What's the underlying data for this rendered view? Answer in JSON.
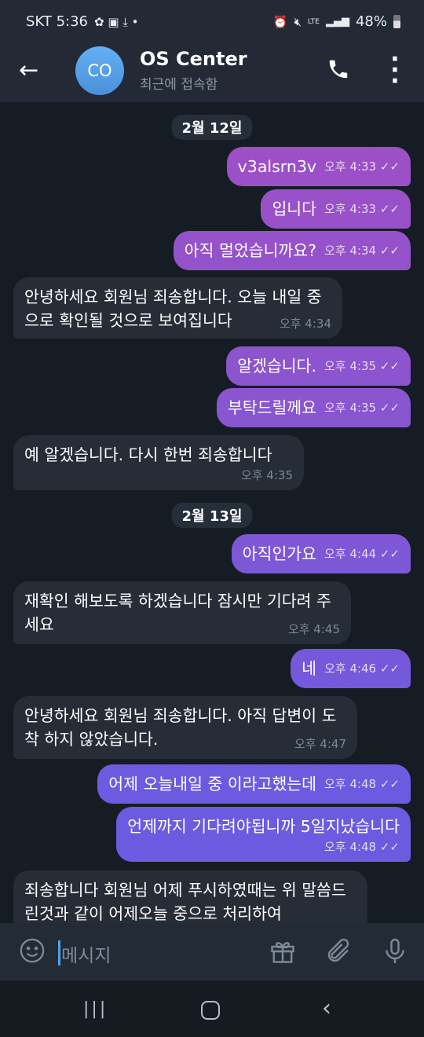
{
  "status_bar": {
    "carrier": "SKT",
    "time": "5:36",
    "battery": "48%",
    "network": "LTE"
  },
  "header": {
    "avatar_initials": "CO",
    "title": "OS Center",
    "subtitle": "최근에 접속함"
  },
  "colors": {
    "outgoing_top": "#a94cc2",
    "outgoing_bottom": "#6c5be0",
    "incoming": "#262d37",
    "background": "#161c23",
    "header": "#232a36"
  },
  "messages": [
    {
      "type": "date",
      "text": "2월 12일"
    },
    {
      "type": "out",
      "text": "v3alsrn3v",
      "time": "오후 4:33"
    },
    {
      "type": "out",
      "text": "입니다",
      "time": "오후 4:33"
    },
    {
      "type": "out",
      "text": "아직 멀었습니까요?",
      "time": "오후 4:34"
    },
    {
      "type": "in",
      "text": "안녕하세요 회원님 죄송합니다. 오늘 내일 중으로 확인될 것으로 보여집니다",
      "time": "오후 4:34"
    },
    {
      "type": "out",
      "text": "알겠습니다.",
      "time": "오후 4:35"
    },
    {
      "type": "out",
      "text": "부탁드릴께요",
      "time": "오후 4:35"
    },
    {
      "type": "in",
      "text": "예 알겠습니다. 다시 한번 죄송합니다",
      "time": "오후 4:35"
    },
    {
      "type": "date",
      "text": "2월 13일"
    },
    {
      "type": "out",
      "text": "아직인가요",
      "time": "오후 4:44"
    },
    {
      "type": "in",
      "text": "재확인 해보도록 하겠습니다 잠시만 기다려 주세요",
      "time": "오후 4:45"
    },
    {
      "type": "out",
      "text": "네",
      "time": "오후 4:46"
    },
    {
      "type": "in",
      "text": "안녕하세요 회원님 죄송합니다. 아직 답변이 도착 하지 않았습니다.",
      "time": "오후 4:47"
    },
    {
      "type": "out",
      "text": "어제 오늘내일 중 이라고했는데",
      "time": "오후 4:48"
    },
    {
      "type": "out",
      "text": "언제까지 기다려야됩니까 5일지났습니다",
      "time": "오후 4:48"
    },
    {
      "type": "in",
      "text": "죄송합니다 회원님 어제 푸시하였때는 위 말씀드린것과 같이 어제오늘 중으로 처리하여"
    }
  ],
  "input": {
    "placeholder": "메시지"
  }
}
